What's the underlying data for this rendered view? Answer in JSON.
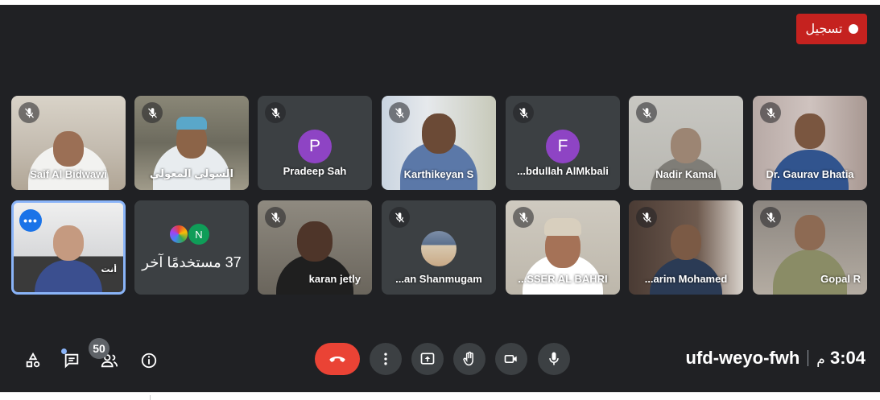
{
  "recording": {
    "label": "تسجيل"
  },
  "tiles_row1": [
    {
      "name": "Saif Al Bidwawi"
    },
    {
      "name": "السولي المعولي"
    },
    {
      "name": "Pradeep Sah",
      "initial": "P"
    },
    {
      "name": "Karthikeyan S"
    },
    {
      "name": "...bdullah AlMkbali",
      "initial": "F"
    },
    {
      "name": "Nadir Kamal"
    },
    {
      "name": "Dr. Gaurav Bhatia"
    }
  ],
  "tiles_row2": [
    {
      "name": "أنت",
      "badge": "•••"
    },
    {
      "others_text": "37 مستخدمًا آخر",
      "initial": "N"
    },
    {
      "name": "karan jetly"
    },
    {
      "name": "...an Shanmugam"
    },
    {
      "name": "...SSER AL BAHRI"
    },
    {
      "name": "...arim Mohamed"
    },
    {
      "name": "Gopal R"
    }
  ],
  "participants": {
    "count": "50"
  },
  "meeting": {
    "code": "ufd-weyo-fwh",
    "time": "3:04",
    "period": "م"
  },
  "colors": {
    "end_call": "#ea4335",
    "recording": "#c5221f",
    "selected_border": "#8ab4f8",
    "stage": "#202124"
  }
}
